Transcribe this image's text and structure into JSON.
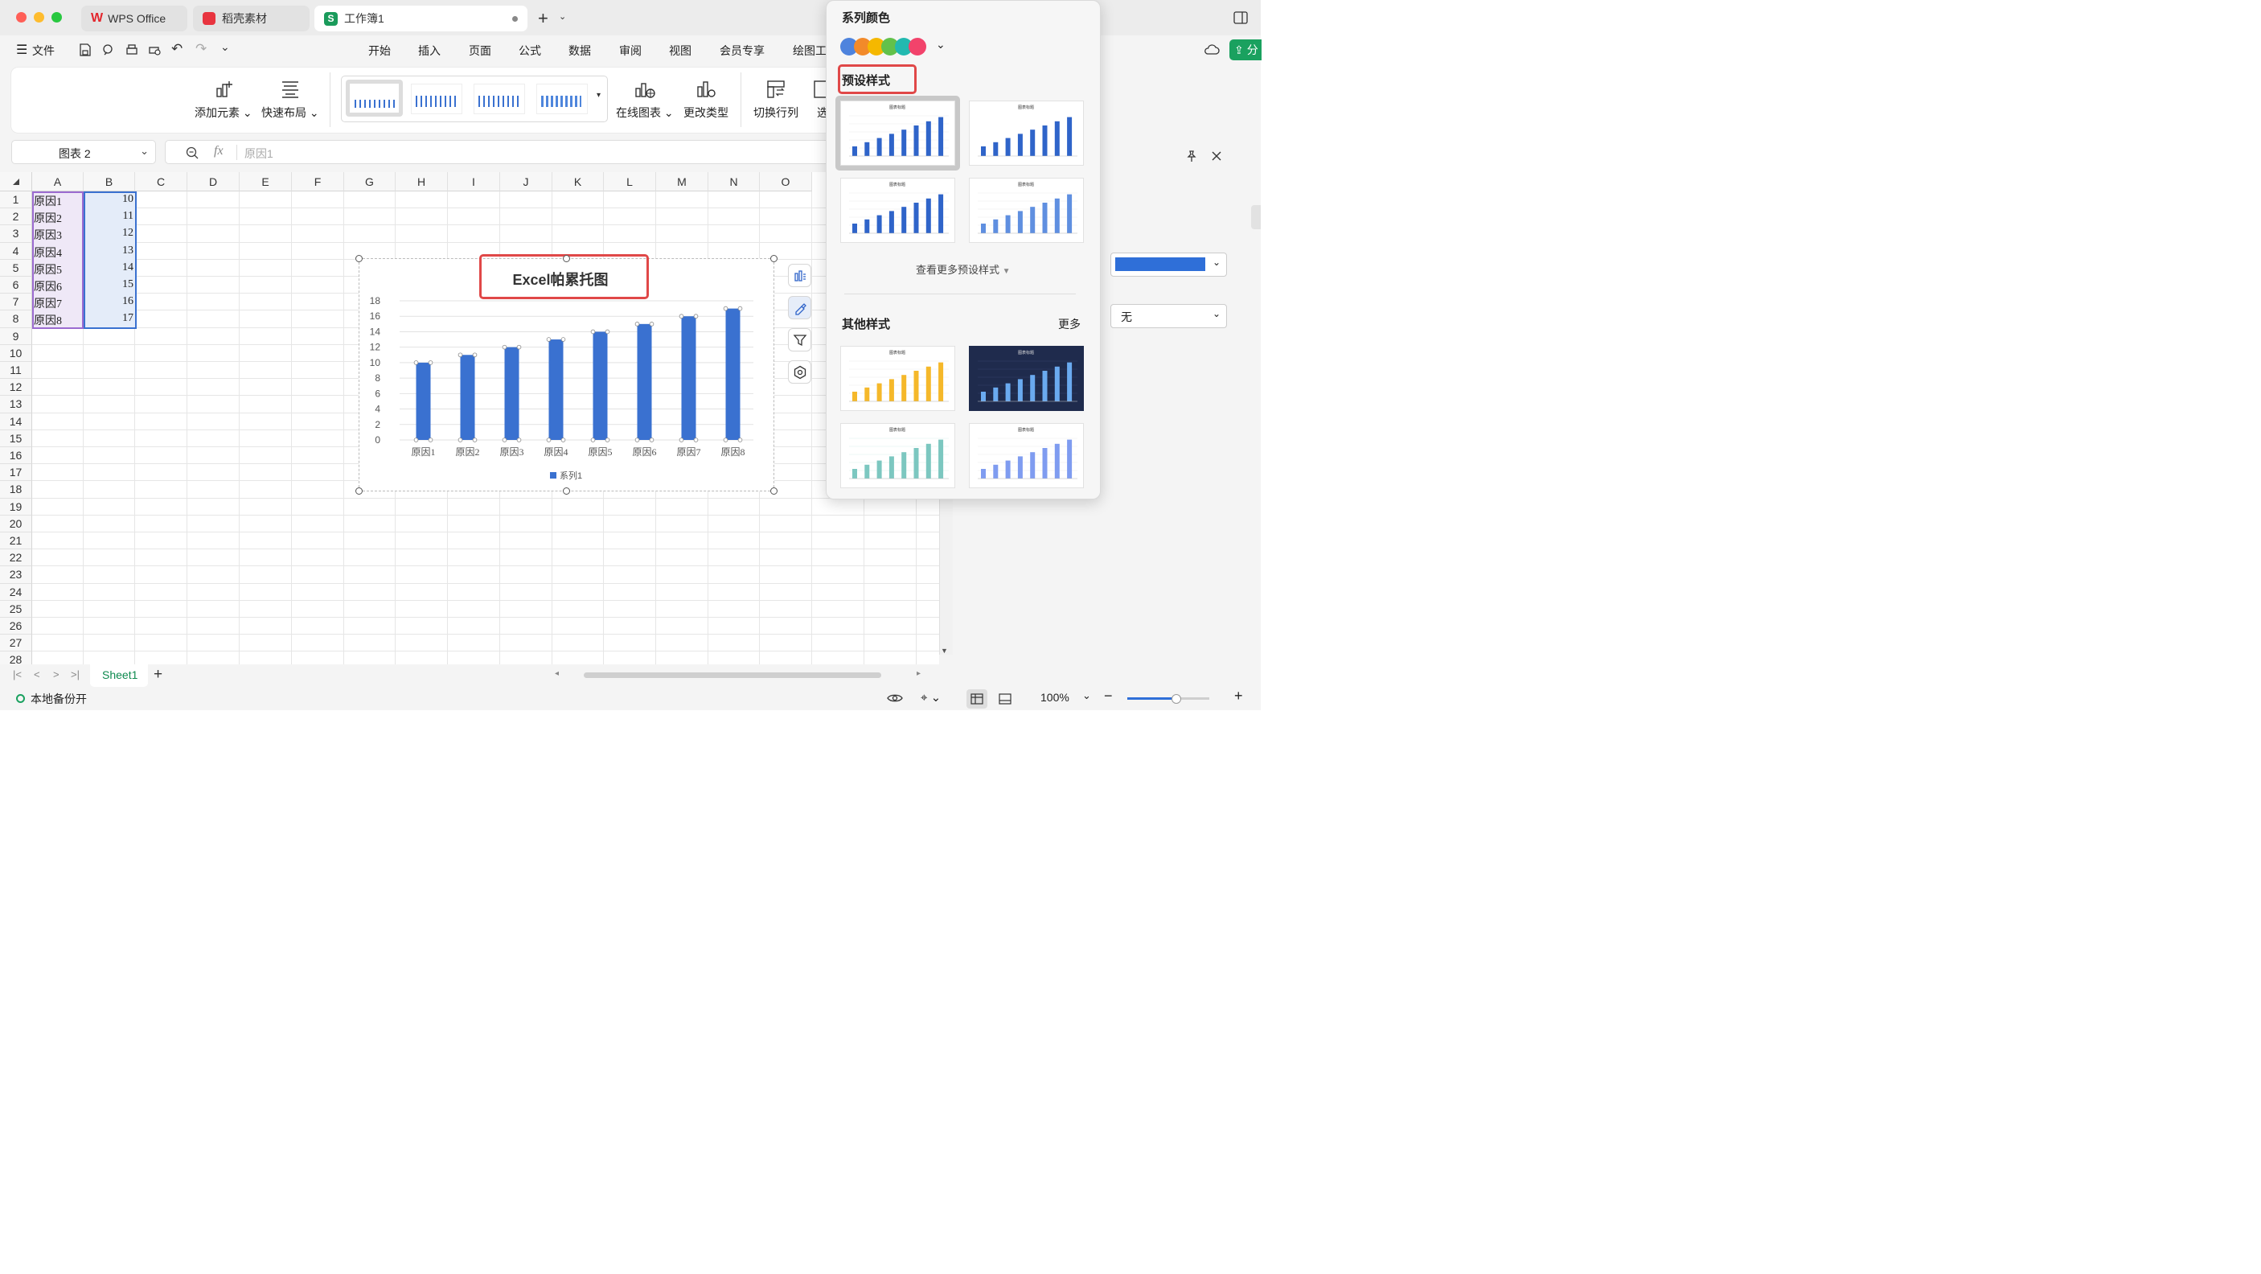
{
  "titlebar": {
    "tabs": [
      {
        "label": "WPS Office"
      },
      {
        "label": "稻壳素材"
      },
      {
        "label": "工作簿1"
      }
    ]
  },
  "menubar": {
    "file_label": "文件",
    "items": [
      "开始",
      "插入",
      "页面",
      "公式",
      "数据",
      "审阅",
      "视图",
      "会员专享",
      "绘图工"
    ],
    "share_label": "分"
  },
  "ribbon": {
    "add_element": "添加元素",
    "quick_layout": "快速布局",
    "online_chart": "在线图表",
    "change_type": "更改类型",
    "switch_row_col": "切换行列",
    "select_data": "选"
  },
  "formula_bar": {
    "name_box": "图表 2",
    "fx": "fx",
    "value": "原因1"
  },
  "sheet": {
    "columns": [
      "A",
      "B",
      "C",
      "D",
      "E",
      "F",
      "G",
      "H",
      "I",
      "J",
      "K",
      "L",
      "M",
      "N",
      "O"
    ],
    "rows": [
      "1",
      "2",
      "3",
      "4",
      "5",
      "6",
      "7",
      "8",
      "9",
      "10",
      "11",
      "12",
      "13",
      "14",
      "15",
      "16",
      "17",
      "18",
      "19",
      "20",
      "21",
      "22",
      "23",
      "24",
      "25",
      "26",
      "27",
      "28"
    ],
    "data": [
      {
        "a": "原因1",
        "b": "10"
      },
      {
        "a": "原因2",
        "b": "11"
      },
      {
        "a": "原因3",
        "b": "12"
      },
      {
        "a": "原因4",
        "b": "13"
      },
      {
        "a": "原因5",
        "b": "14"
      },
      {
        "a": "原因6",
        "b": "15"
      },
      {
        "a": "原因7",
        "b": "16"
      },
      {
        "a": "原因8",
        "b": "17"
      }
    ],
    "tab_label": "Sheet1"
  },
  "chart_data": {
    "type": "bar",
    "title": "Excel帕累托图",
    "categories": [
      "原因1",
      "原因2",
      "原因3",
      "原因4",
      "原因5",
      "原因6",
      "原因7",
      "原因8"
    ],
    "series": [
      {
        "name": "系列1",
        "values": [
          10,
          11,
          12,
          13,
          14,
          15,
          16,
          17
        ],
        "color": "#3a71d0"
      }
    ],
    "ylim": [
      0,
      18
    ],
    "yticks": [
      "0",
      "2",
      "4",
      "6",
      "8",
      "10",
      "12",
      "14",
      "16",
      "18"
    ],
    "grid": true,
    "legend": "bottom"
  },
  "popup": {
    "series_color_title": "系列颜色",
    "palette": [
      "#4e83dd",
      "#f28a2a",
      "#f5b800",
      "#62c14a",
      "#22b9b0",
      "#f2436b"
    ],
    "preset_title": "预设样式",
    "more_presets": "查看更多预设样式",
    "other_title": "其他样式",
    "more": "更多",
    "thumb_title": "图表标题"
  },
  "right_pane": {
    "dropdown2": "无"
  },
  "status": {
    "backup": "本地备份开",
    "zoom": "100%"
  }
}
